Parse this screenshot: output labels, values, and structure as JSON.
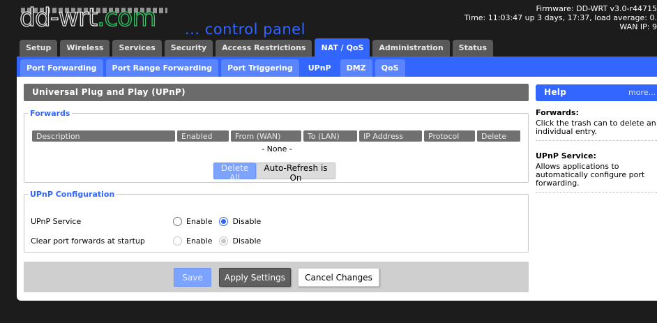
{
  "header": {
    "logo_main": "dd-wrt",
    "logo_tld": ".com",
    "tagline": "... control panel",
    "firmware": "Firmware: DD-WRT v3.0-r44715",
    "time": "Time: 11:03:47 up 3 days, 17:37, load average: 0.",
    "wan_ip": "WAN IP: 9"
  },
  "main_tabs": [
    "Setup",
    "Wireless",
    "Services",
    "Security",
    "Access Restrictions",
    "NAT / QoS",
    "Administration",
    "Status"
  ],
  "sub_tabs": [
    "Port Forwarding",
    "Port Range Forwarding",
    "Port Triggering",
    "UPnP",
    "DMZ",
    "QoS"
  ],
  "page_title": "Universal Plug and Play (UPnP)",
  "forwards": {
    "legend": "Forwards",
    "columns": [
      "Description",
      "Enabled",
      "From (WAN)",
      "To (LAN)",
      "IP Address",
      "Protocol",
      "Delete"
    ],
    "empty_text": "- None -",
    "delete_all_label": "Delete All",
    "auto_refresh_label": "Auto-Refresh is On"
  },
  "upnp_config": {
    "legend": "UPnP Configuration",
    "rows": [
      {
        "label": "UPnP Service",
        "enable": "Enable",
        "disable": "Disable",
        "selected": "disable",
        "disabled": false
      },
      {
        "label": "Clear port forwards at startup",
        "enable": "Enable",
        "disable": "Disable",
        "selected": "disable",
        "disabled": true
      }
    ]
  },
  "actions": {
    "save": "Save",
    "apply": "Apply Settings",
    "cancel": "Cancel Changes"
  },
  "help": {
    "title": "Help",
    "more": "more...",
    "items": [
      {
        "title": "Forwards:",
        "text": "Click the trash can to delete an individual entry."
      },
      {
        "title": "UPnP Service:",
        "text": "Allows applications to automatically configure port forwarding."
      }
    ]
  },
  "colors": {
    "accent": "#3366ff",
    "tab_grey": "#595959",
    "background": "#1c1c1c"
  }
}
